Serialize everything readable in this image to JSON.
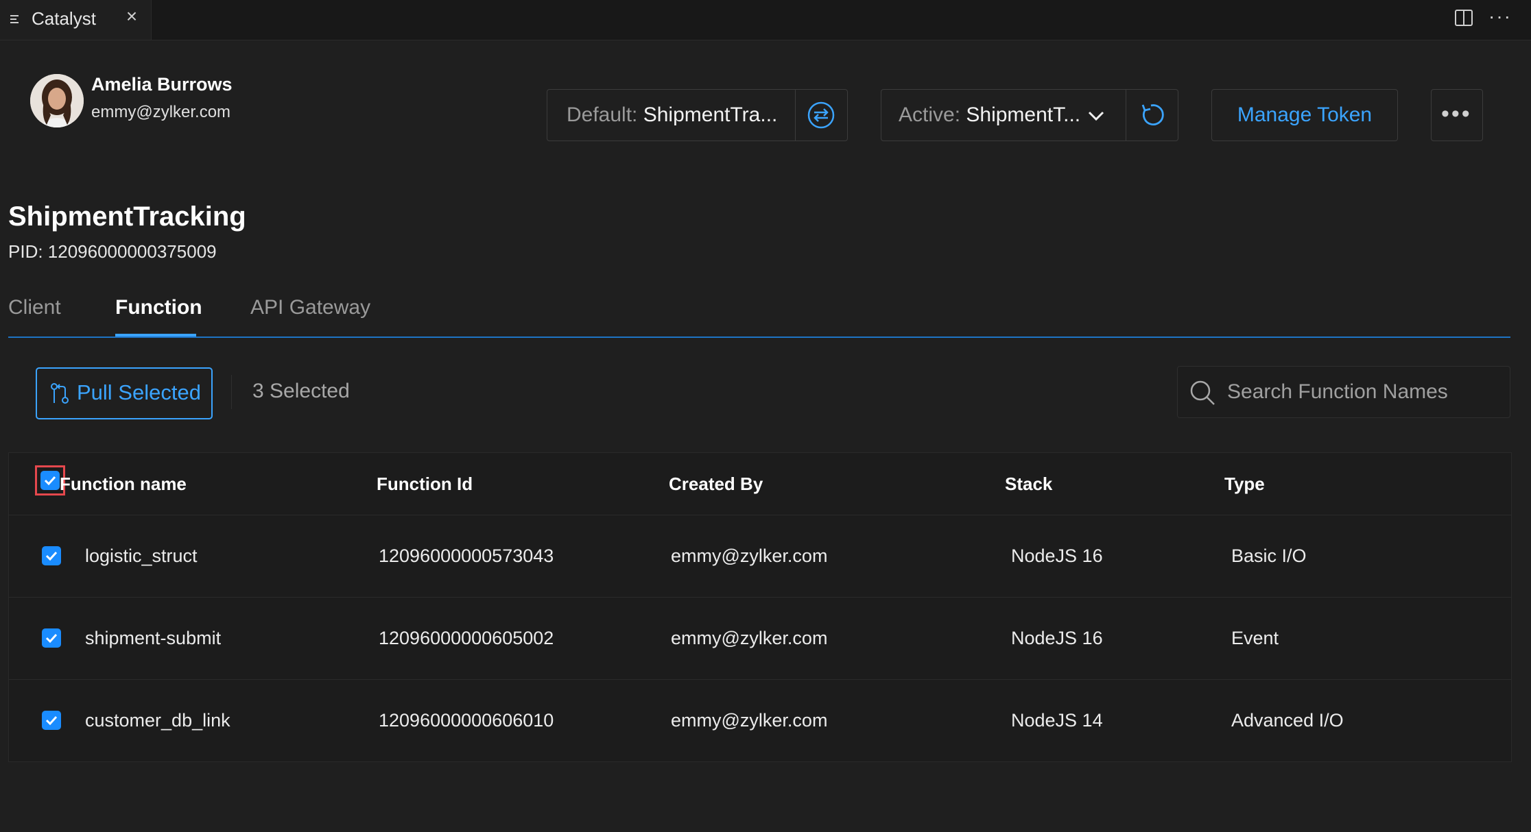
{
  "window": {
    "tab_title": "Catalyst"
  },
  "user": {
    "name": "Amelia Burrows",
    "email": "emmy@zylker.com"
  },
  "project_selectors": {
    "default_label": "Default:",
    "default_value": "ShipmentTra...",
    "active_label": "Active:",
    "active_value": "ShipmentT..."
  },
  "actions": {
    "manage_token": "Manage Token"
  },
  "project": {
    "title": "ShipmentTracking",
    "pid": "PID: 12096000000375009"
  },
  "tabs": [
    "Client",
    "Function",
    "API Gateway"
  ],
  "active_tab": "Function",
  "toolbar": {
    "pull_label": "Pull Selected",
    "selected_count": "3 Selected",
    "search_placeholder": "Search Function Names"
  },
  "table": {
    "columns": [
      "Function name",
      "Function Id",
      "Created By",
      "Stack",
      "Type"
    ],
    "rows": [
      [
        "logistic_struct",
        "12096000000573043",
        "emmy@zylker.com",
        "NodeJS 16",
        "Basic I/O"
      ],
      [
        "shipment-submit",
        "12096000000605002",
        "emmy@zylker.com",
        "NodeJS 16",
        "Event"
      ],
      [
        "customer_db_link",
        "12096000000606010",
        "emmy@zylker.com",
        "NodeJS 14",
        "Advanced I/O"
      ]
    ]
  },
  "colors": {
    "accent": "#3ba4ff",
    "checkbox": "#1a8cff",
    "highlight": "#e5484d",
    "background": "#1f1f1f"
  },
  "icons": [
    "menu-icon",
    "close-icon",
    "split-editor-icon",
    "more-icon",
    "switch-icon",
    "chevron-down-icon",
    "refresh-icon",
    "kebab-icon",
    "pull-request-icon",
    "search-icon",
    "check-icon"
  ]
}
